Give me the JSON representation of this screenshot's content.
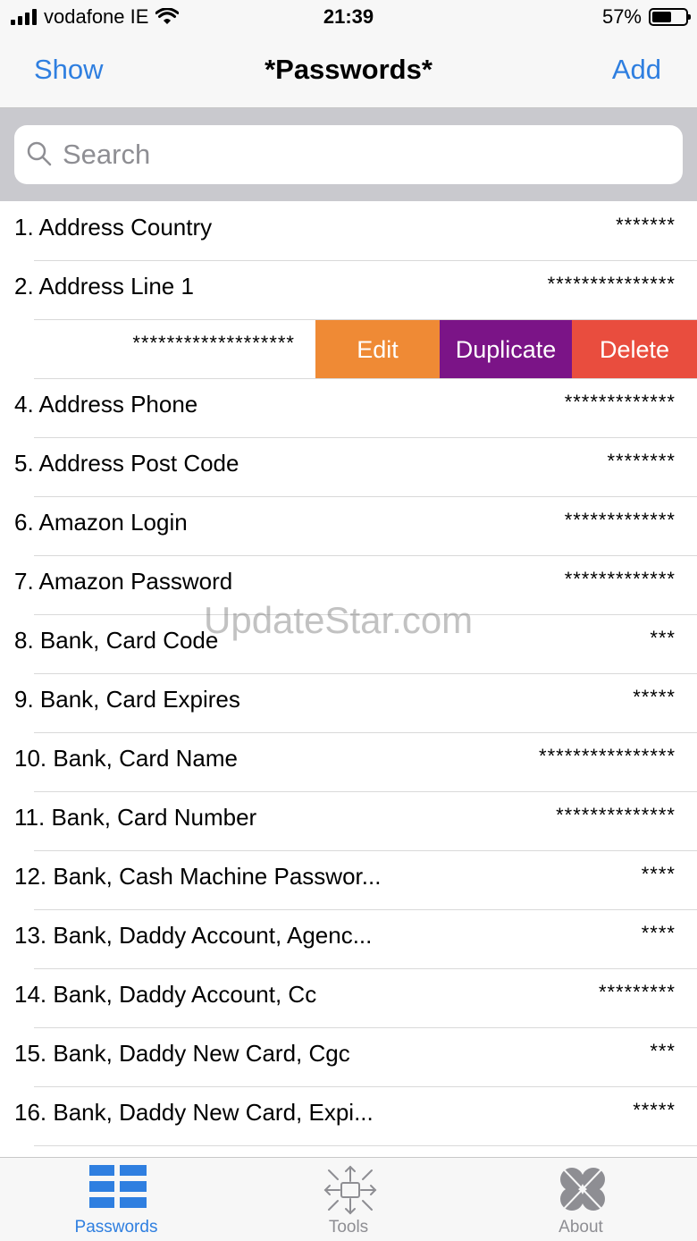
{
  "status": {
    "carrier": "vodafone IE",
    "time": "21:39",
    "battery_text": "57%",
    "battery_level": 0.57
  },
  "nav": {
    "left_label": "Show",
    "title": "*Passwords*",
    "right_label": "Add"
  },
  "search": {
    "placeholder": "Search"
  },
  "rows": [
    {
      "title": "1. Address Country",
      "value": "*******"
    },
    {
      "title": "2. Address Line 1",
      "value": "***************"
    },
    {
      "title": "",
      "value": "*******************"
    },
    {
      "title": "4. Address Phone",
      "value": "*************"
    },
    {
      "title": "5. Address Post Code",
      "value": "********"
    },
    {
      "title": "6. Amazon Login",
      "value": "*************"
    },
    {
      "title": "7. Amazon Password",
      "value": "*************"
    },
    {
      "title": "8. Bank, Card Code",
      "value": "***"
    },
    {
      "title": "9. Bank, Card Expires",
      "value": "*****"
    },
    {
      "title": "10. Bank, Card Name",
      "value": "****************"
    },
    {
      "title": "11. Bank, Card Number",
      "value": "**************"
    },
    {
      "title": "12. Bank, Cash Machine Passwor...",
      "value": "****"
    },
    {
      "title": "13. Bank, Daddy Account, Agenc...",
      "value": "****"
    },
    {
      "title": "14. Bank, Daddy Account, Cc",
      "value": "*********"
    },
    {
      "title": "15. Bank, Daddy New Card, Cgc",
      "value": "***"
    },
    {
      "title": "16. Bank, Daddy New Card, Expi...",
      "value": "*****"
    }
  ],
  "swipe_actions": {
    "edit": "Edit",
    "duplicate": "Duplicate",
    "delete": "Delete"
  },
  "watermark": "UpdateStar.com",
  "tabs": {
    "passwords": "Passwords",
    "tools": "Tools",
    "about": "About"
  },
  "colors": {
    "accent": "#2f7fe0",
    "edit": "#ef8a35",
    "duplicate": "#7b1487",
    "delete": "#e94d3e"
  }
}
